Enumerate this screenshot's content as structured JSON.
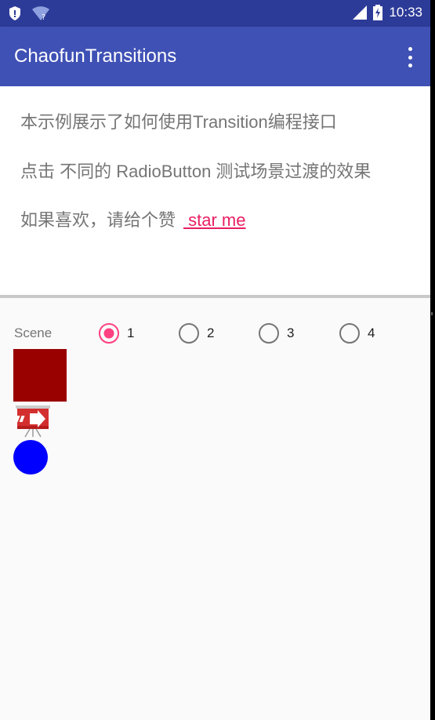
{
  "status_bar": {
    "time": "10:33",
    "icons": [
      "shield-icon",
      "wifi-question-icon",
      "signal-icon",
      "battery-charging-icon"
    ]
  },
  "app_bar": {
    "title": "ChaofunTransitions",
    "menu_icon": "overflow-menu-icon"
  },
  "intro": {
    "line1": "本示例展示了如何使用Transition编程接口",
    "line2": "点击 不同的 RadioButton 测试场景过渡的效果",
    "line3_prefix": "如果喜欢，请给个赞",
    "star_link": " star me"
  },
  "scene": {
    "label": "Scene",
    "options": [
      {
        "label": "1",
        "checked": true
      },
      {
        "label": "2",
        "checked": false
      },
      {
        "label": "3",
        "checked": false
      },
      {
        "label": "4",
        "checked": false
      }
    ]
  },
  "colors": {
    "status_bar": "#2d3b98",
    "app_bar": "#3f51b5",
    "accent": "#ff4081",
    "link": "#e91e63",
    "red_square": "#990000",
    "blue_circle": "#0000ff"
  },
  "shapes": {
    "square": "red-square",
    "icon": "presentation-icon",
    "circle": "blue-circle"
  }
}
